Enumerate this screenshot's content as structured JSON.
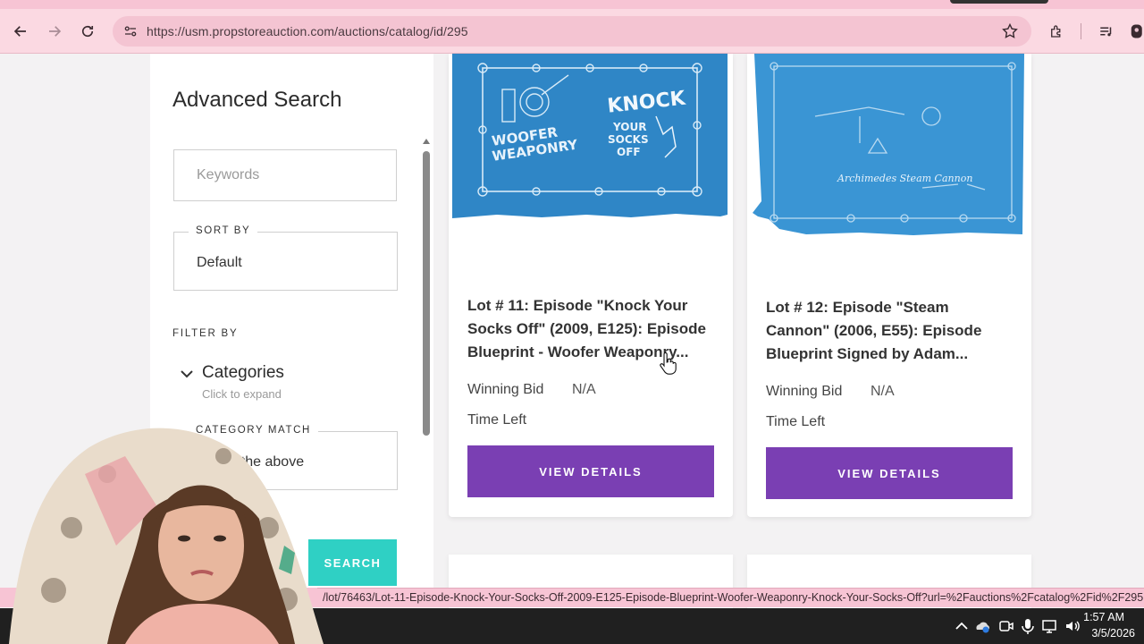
{
  "browser": {
    "url": "https://usm.propstoreauction.com/auctions/catalog/id/295",
    "icons": [
      "back-arrow-icon",
      "forward-arrow-icon",
      "reload-icon",
      "site-info-icon",
      "star-icon",
      "extensions-icon",
      "media-icon",
      "profile-icon"
    ]
  },
  "sidebar": {
    "title": "Advanced Search",
    "keywords_placeholder": "Keywords",
    "sort_by_label": "SORT BY",
    "sort_by_value": "Default",
    "filter_by_label": "FILTER BY",
    "categories_label": "Categories",
    "categories_hint": "Click to expand",
    "category_match_label": "CATEGORY MATCH",
    "category_match_value": "Any of the above",
    "search_button": "SEARCH"
  },
  "lots": [
    {
      "title": "Lot # 11: Episode \"Knock Your Socks Off\" (2009, E125): Episode Blueprint - Woofer Weaponry...",
      "winning_bid_label": "Winning Bid",
      "winning_bid_value": "N/A",
      "time_left_label": "Time Left",
      "button": "VIEW DETAILS",
      "image_texts": [
        "WOOFER WEAPONRY",
        "KNOCK YOUR SOCKS OFF"
      ]
    },
    {
      "title": "Lot # 12: Episode \"Steam Cannon\" (2006, E55): Episode Blueprint Signed by Adam...",
      "winning_bid_label": "Winning Bid",
      "winning_bid_value": "N/A",
      "time_left_label": "Time Left",
      "button": "VIEW DETAILS",
      "image_texts": [
        "Archimedes Steam Cannon"
      ]
    }
  ],
  "statusbar": {
    "link": "/lot/76463/Lot-11-Episode-Knock-Your-Socks-Off-2009-E125-Episode-Blueprint-Woofer-Weaponry-Knock-Your-Socks-Off?url=%2Fauctions%2Fcatalog%2Fid%2F295"
  },
  "taskbar": {
    "time": "1:57 AM",
    "date": "3/5/2026"
  },
  "colors": {
    "view_button": "#7a3fb3",
    "search_button": "#2fd0c4",
    "blueprint": "#2f86c6",
    "chrome_pink": "#fbd9e2"
  }
}
